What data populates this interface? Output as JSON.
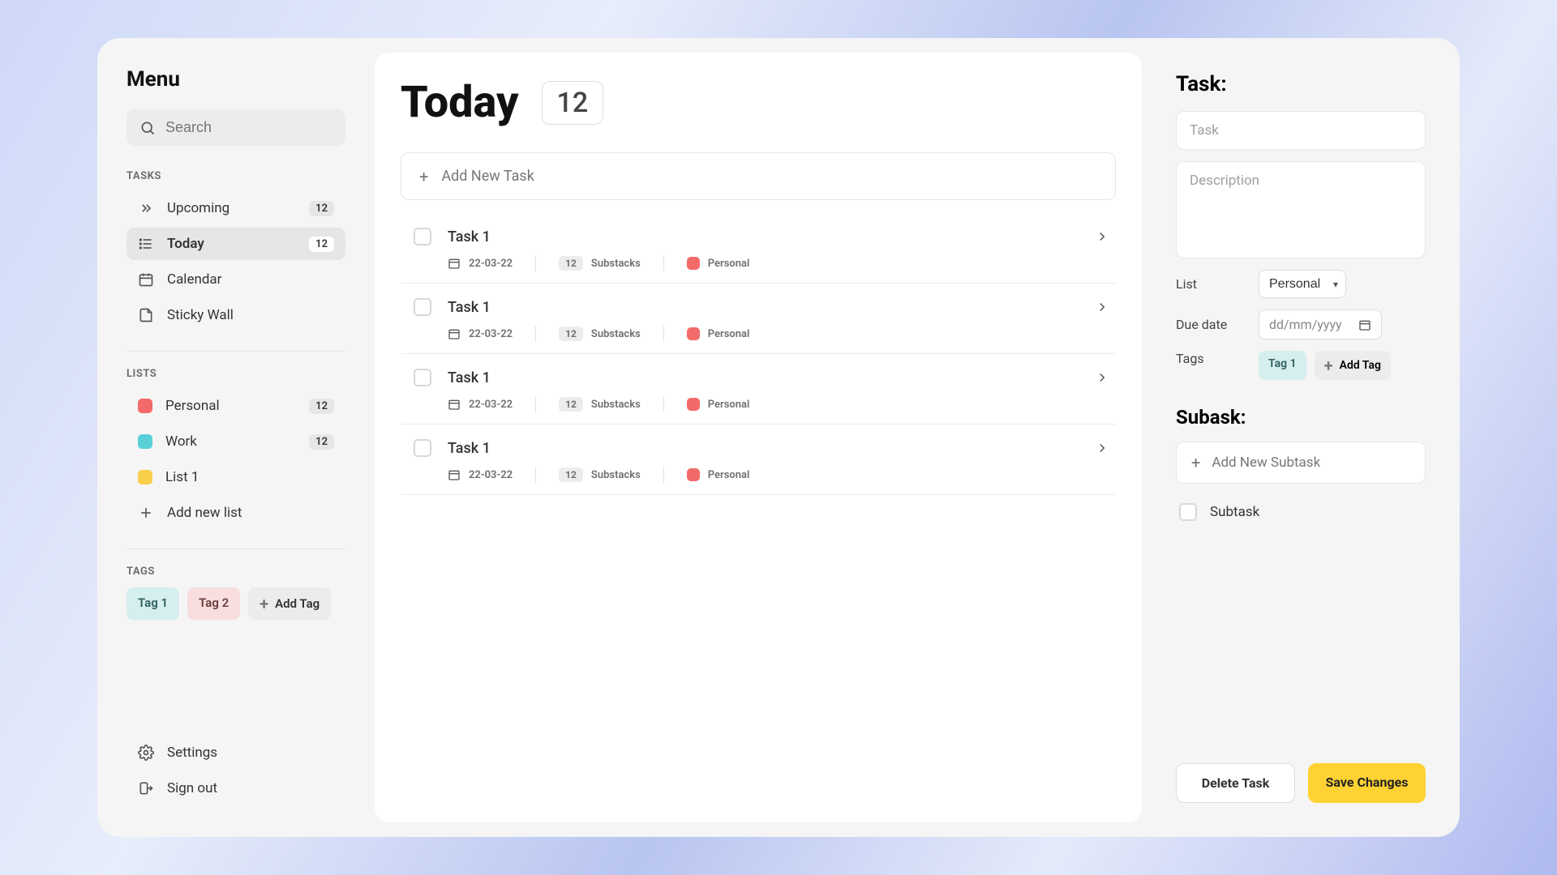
{
  "sidebar": {
    "title": "Menu",
    "search_placeholder": "Search",
    "tasks_label": "TASKS",
    "nav": {
      "upcoming": {
        "label": "Upcoming",
        "count": "12"
      },
      "today": {
        "label": "Today",
        "count": "12"
      },
      "calendar": {
        "label": "Calendar"
      },
      "sticky": {
        "label": "Sticky Wall"
      }
    },
    "lists_label": "LISTS",
    "lists": {
      "personal": {
        "label": "Personal",
        "count": "12",
        "color": "#f36a6a"
      },
      "work": {
        "label": "Work",
        "count": "12",
        "color": "#59d0d8"
      },
      "list1": {
        "label": "List 1",
        "color": "#f9cf4b"
      }
    },
    "add_list": "Add new list",
    "tags_label": "TAGS",
    "tags": {
      "tag1": "Tag 1",
      "tag2": "Tag 2",
      "add": "Add Tag"
    },
    "settings": "Settings",
    "signout": "Sign out"
  },
  "main": {
    "title": "Today",
    "count": "12",
    "add_new": "Add New Task",
    "task_title": "Task 1",
    "date": "22-03-22",
    "sub_count": "12",
    "sub_label": "Substacks",
    "list_label": "Personal",
    "list_color": "#f36a6a"
  },
  "detail": {
    "title": "Task:",
    "task_placeholder": "Task",
    "desc_placeholder": "Description",
    "list_label": "List",
    "list_value": "Personal",
    "due_label": "Due date",
    "due_placeholder": "dd/mm/yyyy",
    "tags_label": "Tags",
    "tag1": "Tag 1",
    "add_tag": "Add Tag",
    "subtask_title": "Subask:",
    "add_subtask": "Add New Subtask",
    "subtask_item": "Subtask",
    "delete": "Delete Task",
    "save": "Save Changes"
  }
}
